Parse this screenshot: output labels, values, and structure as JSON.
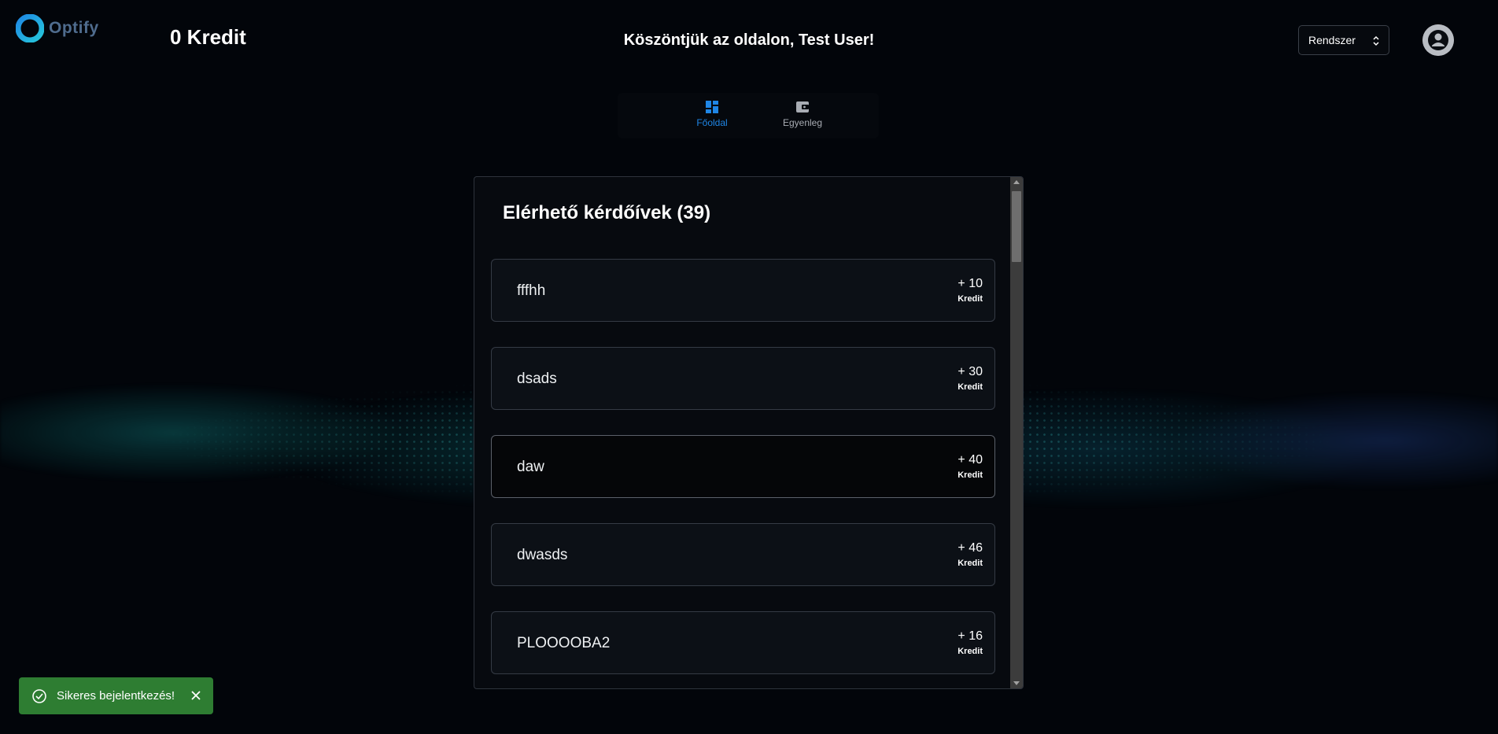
{
  "brand": {
    "name": "Optify"
  },
  "header": {
    "credit_label": "0 Kredit",
    "welcome": "Köszöntjük az oldalon, Test User!",
    "theme_select": {
      "value": "Rendszer"
    }
  },
  "nav": {
    "items": [
      {
        "label": "Főoldal",
        "icon": "dashboard-icon",
        "active": true
      },
      {
        "label": "Egyenleg",
        "icon": "wallet-icon",
        "active": false
      }
    ],
    "active_color": "#1f86e6"
  },
  "surveys": {
    "title": "Elérhető kérdőívek (39)",
    "items": [
      {
        "name": "fffhh",
        "points": "+ 10",
        "unit": "Kredit"
      },
      {
        "name": "dsads",
        "points": "+ 30",
        "unit": "Kredit"
      },
      {
        "name": "daw",
        "points": "+ 40",
        "unit": "Kredit"
      },
      {
        "name": "dwasds",
        "points": "+ 46",
        "unit": "Kredit"
      },
      {
        "name": "PLOOOOBA2",
        "points": "+ 16",
        "unit": "Kredit"
      }
    ]
  },
  "toast": {
    "message": "Sikeres bejelentkezés!",
    "color": "#2e7d32"
  }
}
